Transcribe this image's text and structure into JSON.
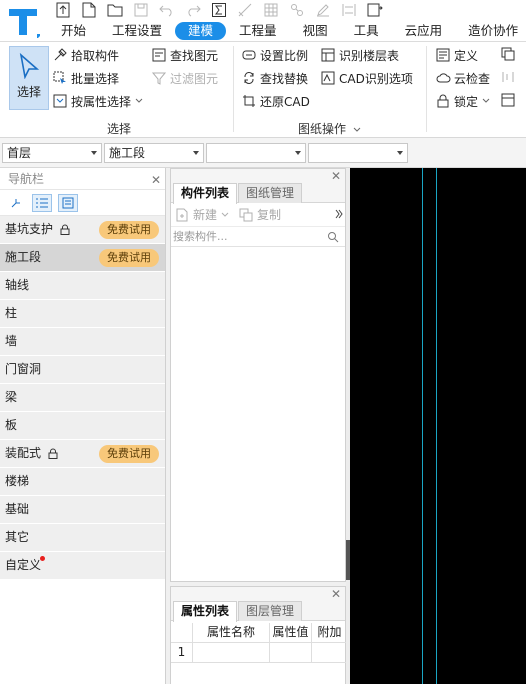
{
  "menu": {
    "tabs": [
      "开始",
      "工程设置",
      "建模",
      "工程量",
      "视图",
      "工具",
      "云应用",
      "造价协作"
    ],
    "active": "建模"
  },
  "ribbon": {
    "select_group": {
      "big_button": "选择",
      "pick": "拾取构件",
      "batch": "批量选择",
      "by_attr": "按属性选择",
      "find": "查找图元",
      "filter": "过滤图元",
      "label": "选择"
    },
    "drawing_group": {
      "set_scale": "设置比例",
      "find_replace": "查找替换",
      "restore_cad": "还原CAD",
      "recognize_floor": "识别楼层表",
      "cad_options": "CAD识别选项",
      "label": "图纸操作"
    },
    "right_group": {
      "define": "定义",
      "cloud_check": "云检查",
      "lock": "锁定"
    }
  },
  "combos": [
    "首层",
    "施工段",
    "",
    ""
  ],
  "nav": {
    "title": "导航栏",
    "items": [
      {
        "label": "基坑支护",
        "lock": true,
        "badge": "免费试用",
        "selected": false
      },
      {
        "label": "施工段",
        "lock": false,
        "badge": "免费试用",
        "selected": true
      },
      {
        "label": "轴线",
        "lock": false,
        "badge": "",
        "selected": false
      },
      {
        "label": "柱",
        "lock": false,
        "badge": "",
        "selected": false
      },
      {
        "label": "墙",
        "lock": false,
        "badge": "",
        "selected": false
      },
      {
        "label": "门窗洞",
        "lock": false,
        "badge": "",
        "selected": false
      },
      {
        "label": "梁",
        "lock": false,
        "badge": "",
        "selected": false
      },
      {
        "label": "板",
        "lock": false,
        "badge": "",
        "selected": false
      },
      {
        "label": "装配式",
        "lock": true,
        "badge": "免费试用",
        "selected": false
      },
      {
        "label": "楼梯",
        "lock": false,
        "badge": "",
        "selected": false
      },
      {
        "label": "基础",
        "lock": false,
        "badge": "",
        "selected": false
      },
      {
        "label": "其它",
        "lock": false,
        "badge": "",
        "selected": false
      },
      {
        "label": "自定义",
        "lock": false,
        "badge": "",
        "selected": false
      }
    ]
  },
  "component_panel": {
    "tab_active": "构件列表",
    "tab_other": "图纸管理",
    "new_label": "新建",
    "copy_label": "复制",
    "search_placeholder": "搜索构件..."
  },
  "property_panel": {
    "tab_active": "属性列表",
    "tab_other": "图层管理",
    "col_name": "属性名称",
    "col_value": "属性值",
    "col_extra": "附加",
    "row1_index": "1"
  },
  "colors": {
    "accent": "#1b8ee8",
    "badge": "#f8c87a",
    "canvas": "#000000",
    "cad_line": "#1aa6c4"
  }
}
